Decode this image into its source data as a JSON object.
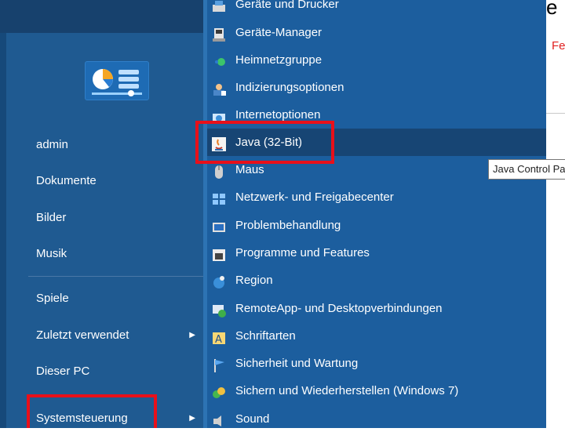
{
  "places": {
    "admin": "admin",
    "documents": "Dokumente",
    "pictures": "Bilder",
    "music": "Musik",
    "games": "Spiele",
    "recent": "Zuletzt verwendet",
    "this_pc": "Dieser PC",
    "control_panel": "Systemsteuerung"
  },
  "submenu": {
    "items": [
      {
        "label": "Geräte und Drucker",
        "icon": "devices-printers-icon"
      },
      {
        "label": "Geräte-Manager",
        "icon": "device-manager-icon"
      },
      {
        "label": "Heimnetzgruppe",
        "icon": "homegroup-icon"
      },
      {
        "label": "Indizierungsoptionen",
        "icon": "indexing-options-icon"
      },
      {
        "label": "Internetoptionen",
        "icon": "internet-options-icon"
      },
      {
        "label": "Java (32-Bit)",
        "icon": "java-icon"
      },
      {
        "label": "Maus",
        "icon": "mouse-icon"
      },
      {
        "label": "Netzwerk- und Freigabecenter",
        "icon": "network-icon"
      },
      {
        "label": "Problembehandlung",
        "icon": "troubleshooting-icon"
      },
      {
        "label": "Programme und Features",
        "icon": "programs-features-icon"
      },
      {
        "label": "Region",
        "icon": "region-icon"
      },
      {
        "label": "RemoteApp- und Desktopverbindungen",
        "icon": "remoteapp-icon"
      },
      {
        "label": "Schriftarten",
        "icon": "fonts-icon"
      },
      {
        "label": "Sicherheit und Wartung",
        "icon": "security-maintenance-icon"
      },
      {
        "label": "Sichern und Wiederherstellen (Windows 7)",
        "icon": "backup-restore-icon"
      },
      {
        "label": "Sound",
        "icon": "sound-icon"
      }
    ]
  },
  "tooltip": "Java Control Panel",
  "background": {
    "red_text": "Fe",
    "top_text": "e"
  },
  "colors": {
    "menu_blue": "#1c5e9e",
    "left_blue": "#1f5a91",
    "hover": "#174574",
    "highlight_red": "#e8101a"
  }
}
